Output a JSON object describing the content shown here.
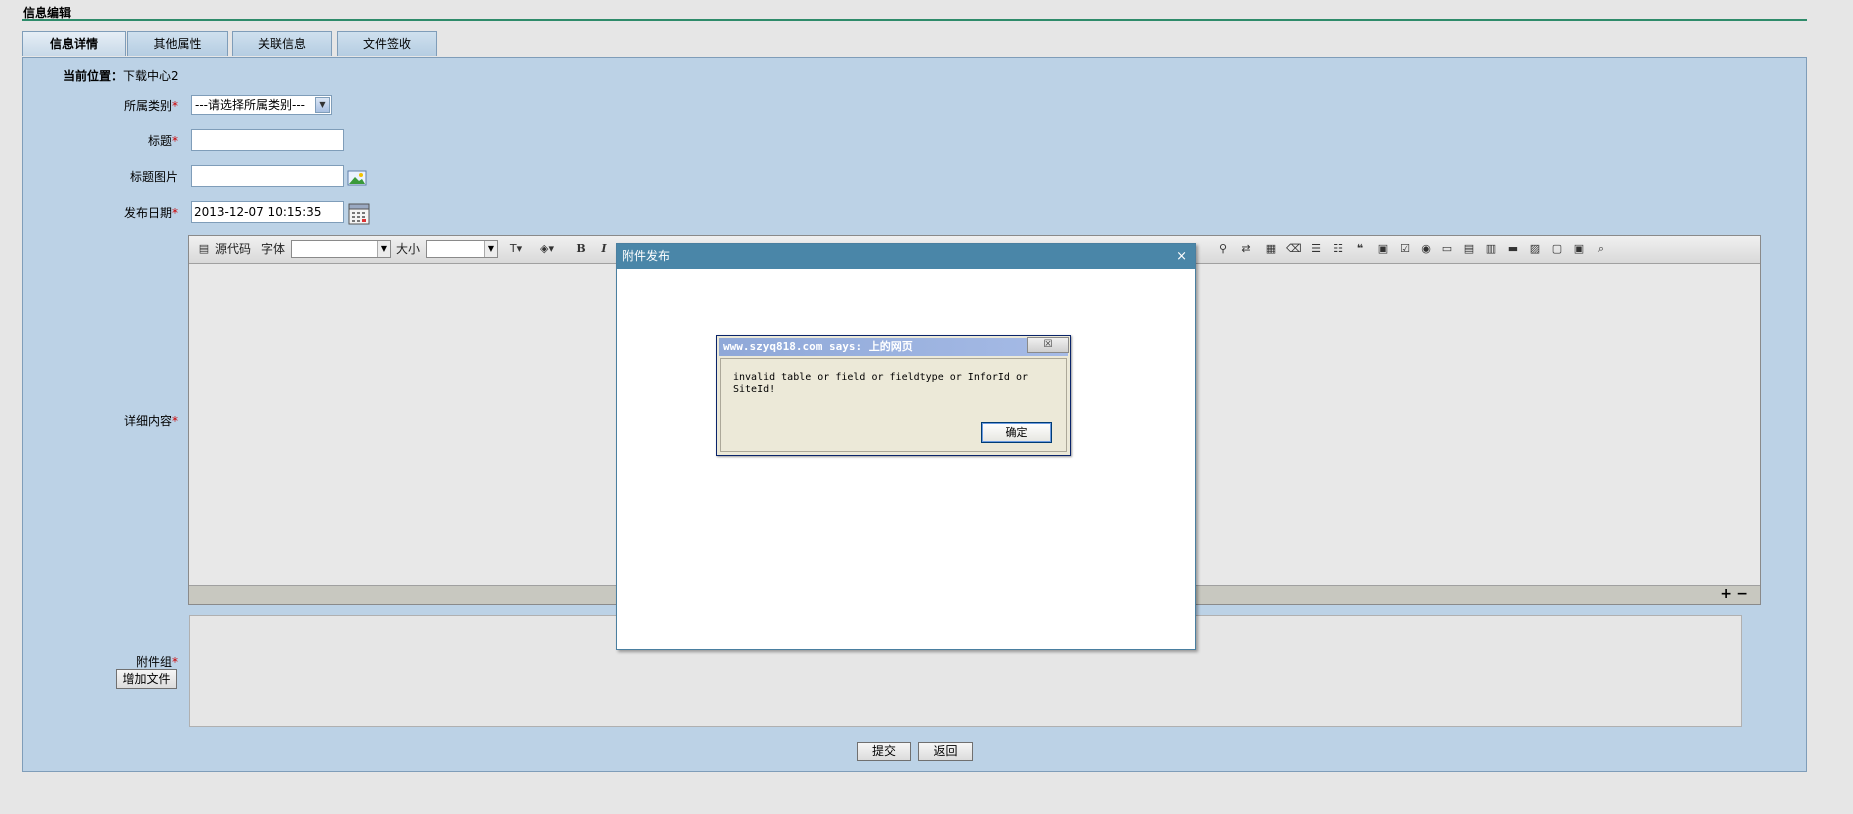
{
  "page": {
    "title": "信息编辑",
    "accent_color": "#2e8b6a",
    "panel_color": "#bcd2e6"
  },
  "tabs": [
    {
      "label": "信息详情",
      "active": true
    },
    {
      "label": "其他属性",
      "active": false
    },
    {
      "label": "关联信息",
      "active": false
    },
    {
      "label": "文件签收",
      "active": false
    }
  ],
  "location": {
    "prefix": "当前位置：",
    "value": "下载中心2"
  },
  "form": {
    "category": {
      "label": "所属类别",
      "required_mark": "*",
      "selected": "---请选择所属类别---"
    },
    "title": {
      "label": "标题",
      "required_mark": "*",
      "value": ""
    },
    "title_image": {
      "label": "标题图片",
      "value": "",
      "icon": "image-icon"
    },
    "publish_date": {
      "label": "发布日期",
      "required_mark": "*",
      "value": "2013-12-07 10:15:35",
      "icon": "calendar-icon"
    },
    "content": {
      "label": "详细内容",
      "required_mark": "*"
    },
    "attachments": {
      "label": "附件组",
      "required_mark": "*",
      "add_button": "增加文件"
    }
  },
  "editor": {
    "source_label": "源代码",
    "font_label": "字体",
    "size_label": "大小",
    "bold": "B",
    "italic": "I",
    "expand": "+",
    "shrink": "−"
  },
  "actions": {
    "submit": "提交",
    "back": "返回"
  },
  "modal": {
    "title": "附件发布",
    "close": "×"
  },
  "alert": {
    "title": "www.szyq818.com says: 上的网页",
    "close": "☒",
    "message": "invalid table or field or fieldtype or InforId or SiteId!",
    "ok": "确定"
  }
}
